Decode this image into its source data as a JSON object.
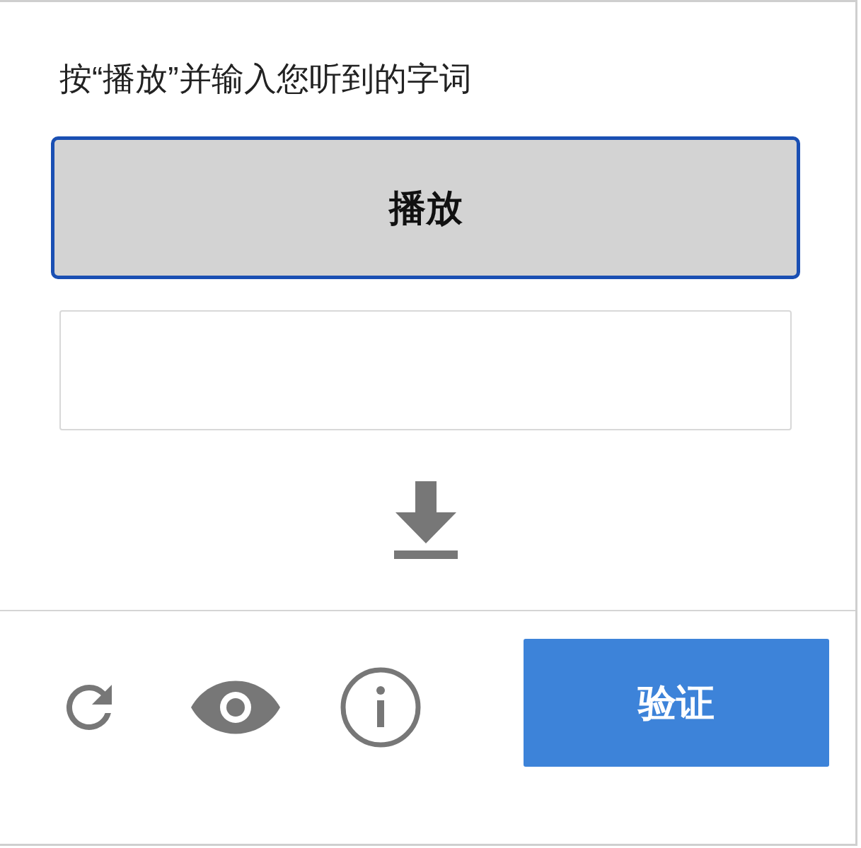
{
  "instruction": "按“播放”并输入您听到的字词",
  "play_button": {
    "label": "播放",
    "focused": true
  },
  "verify_button": {
    "label": "验证"
  }
}
